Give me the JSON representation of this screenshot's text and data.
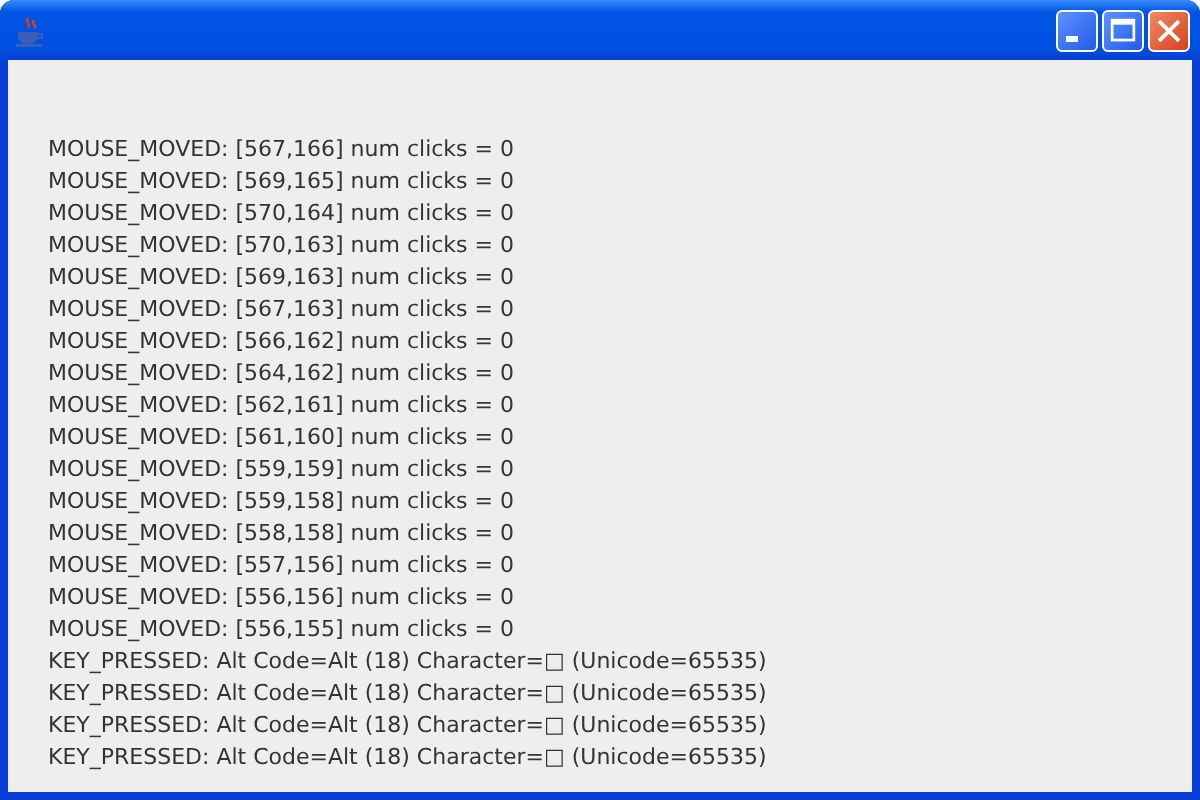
{
  "log_lines": [
    "MOUSE_MOVED: [567,166] num clicks = 0",
    "MOUSE_MOVED: [569,165] num clicks = 0",
    "MOUSE_MOVED: [570,164] num clicks = 0",
    "MOUSE_MOVED: [570,163] num clicks = 0",
    "MOUSE_MOVED: [569,163] num clicks = 0",
    "MOUSE_MOVED: [567,163] num clicks = 0",
    "MOUSE_MOVED: [566,162] num clicks = 0",
    "MOUSE_MOVED: [564,162] num clicks = 0",
    "MOUSE_MOVED: [562,161] num clicks = 0",
    "MOUSE_MOVED: [561,160] num clicks = 0",
    "MOUSE_MOVED: [559,159] num clicks = 0",
    "MOUSE_MOVED: [559,158] num clicks = 0",
    "MOUSE_MOVED: [558,158] num clicks = 0",
    "MOUSE_MOVED: [557,156] num clicks = 0",
    "MOUSE_MOVED: [556,156] num clicks = 0",
    "MOUSE_MOVED: [556,155] num clicks = 0",
    "KEY_PRESSED: Alt Code=Alt (18) Character=□ (Unicode=65535)",
    "KEY_PRESSED: Alt Code=Alt (18) Character=□ (Unicode=65535)",
    "KEY_PRESSED: Alt Code=Alt (18) Character=□ (Unicode=65535)",
    "KEY_PRESSED: Alt Code=Alt (18) Character=□ (Unicode=65535)"
  ]
}
